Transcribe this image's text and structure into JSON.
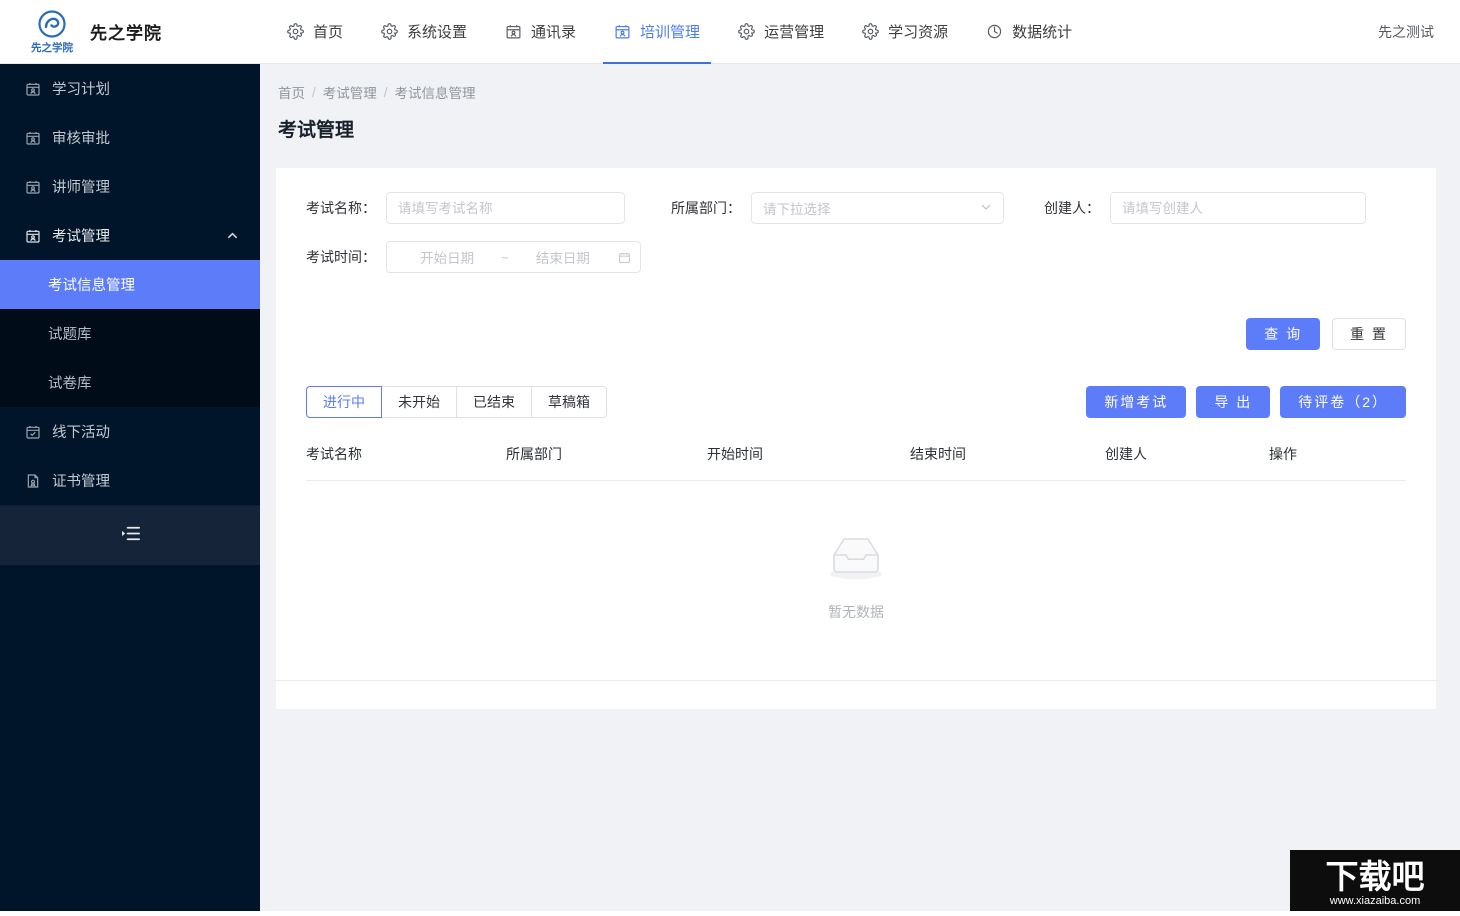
{
  "header": {
    "brand_name": "先之学院",
    "logo_text": "先之学院",
    "user": "先之测试",
    "nav": [
      {
        "label": "首页",
        "icon": "gear-icon",
        "active": false
      },
      {
        "label": "系统设置",
        "icon": "gear-icon",
        "active": false
      },
      {
        "label": "通讯录",
        "icon": "calendar-user-icon",
        "active": false
      },
      {
        "label": "培训管理",
        "icon": "calendar-user-icon",
        "active": true
      },
      {
        "label": "运营管理",
        "icon": "gear-icon",
        "active": false
      },
      {
        "label": "学习资源",
        "icon": "gear-icon",
        "active": false
      },
      {
        "label": "数据统计",
        "icon": "pie-clock-icon",
        "active": false
      }
    ]
  },
  "sidebar": {
    "items": [
      {
        "label": "学习计划",
        "icon": "calendar-user-icon"
      },
      {
        "label": "审核审批",
        "icon": "calendar-user-icon"
      },
      {
        "label": "讲师管理",
        "icon": "calendar-user-icon"
      },
      {
        "label": "考试管理",
        "icon": "calendar-user-icon",
        "expanded": true
      },
      {
        "label": "线下活动",
        "icon": "calendar-check-icon"
      },
      {
        "label": "证书管理",
        "icon": "certificate-icon"
      }
    ],
    "submenu": [
      {
        "label": "考试信息管理",
        "active": true
      },
      {
        "label": "试题库",
        "active": false
      },
      {
        "label": "试卷库",
        "active": false
      }
    ],
    "collapse_icon": "menu-fold-icon"
  },
  "breadcrumb": {
    "items": [
      "首页",
      "考试管理",
      "考试信息管理"
    ],
    "separator": "/"
  },
  "page": {
    "title": "考试管理"
  },
  "search_form": {
    "exam_name": {
      "label": "考试名称：",
      "placeholder": "请填写考试名称",
      "value": ""
    },
    "department": {
      "label": "所属部门：",
      "placeholder": "请下拉选择",
      "value": ""
    },
    "creator": {
      "label": "创建人：",
      "placeholder": "请填写创建人",
      "value": ""
    },
    "exam_time": {
      "label": "考试时间：",
      "start_placeholder": "开始日期",
      "end_placeholder": "结束日期",
      "separator": "~",
      "icon": "calendar-icon"
    },
    "query_button": "查 询",
    "reset_button": "重 置"
  },
  "toolbar": {
    "tabs": [
      {
        "label": "进行中",
        "active": true
      },
      {
        "label": "未开始",
        "active": false
      },
      {
        "label": "已结束",
        "active": false
      },
      {
        "label": "草稿箱",
        "active": false
      }
    ],
    "actions": [
      {
        "label": "新增考试",
        "style": "primary"
      },
      {
        "label": "导 出",
        "style": "primary"
      },
      {
        "label": "待评卷（2）",
        "style": "primary"
      }
    ]
  },
  "table": {
    "columns": [
      "考试名称",
      "所属部门",
      "开始时间",
      "结束时间",
      "创建人",
      "操作"
    ],
    "rows": [],
    "empty_text": "暂无数据",
    "empty_icon": "empty-inbox-icon"
  },
  "watermark": {
    "title": "下载吧",
    "url": "www.xiazaiba.com"
  },
  "colors": {
    "accent": "#5c7cfa",
    "nav_active": "#4c7df0",
    "sidebar_bg": "#001529",
    "submenu_bg": "#000c17",
    "page_bg": "#f0f2f5"
  }
}
